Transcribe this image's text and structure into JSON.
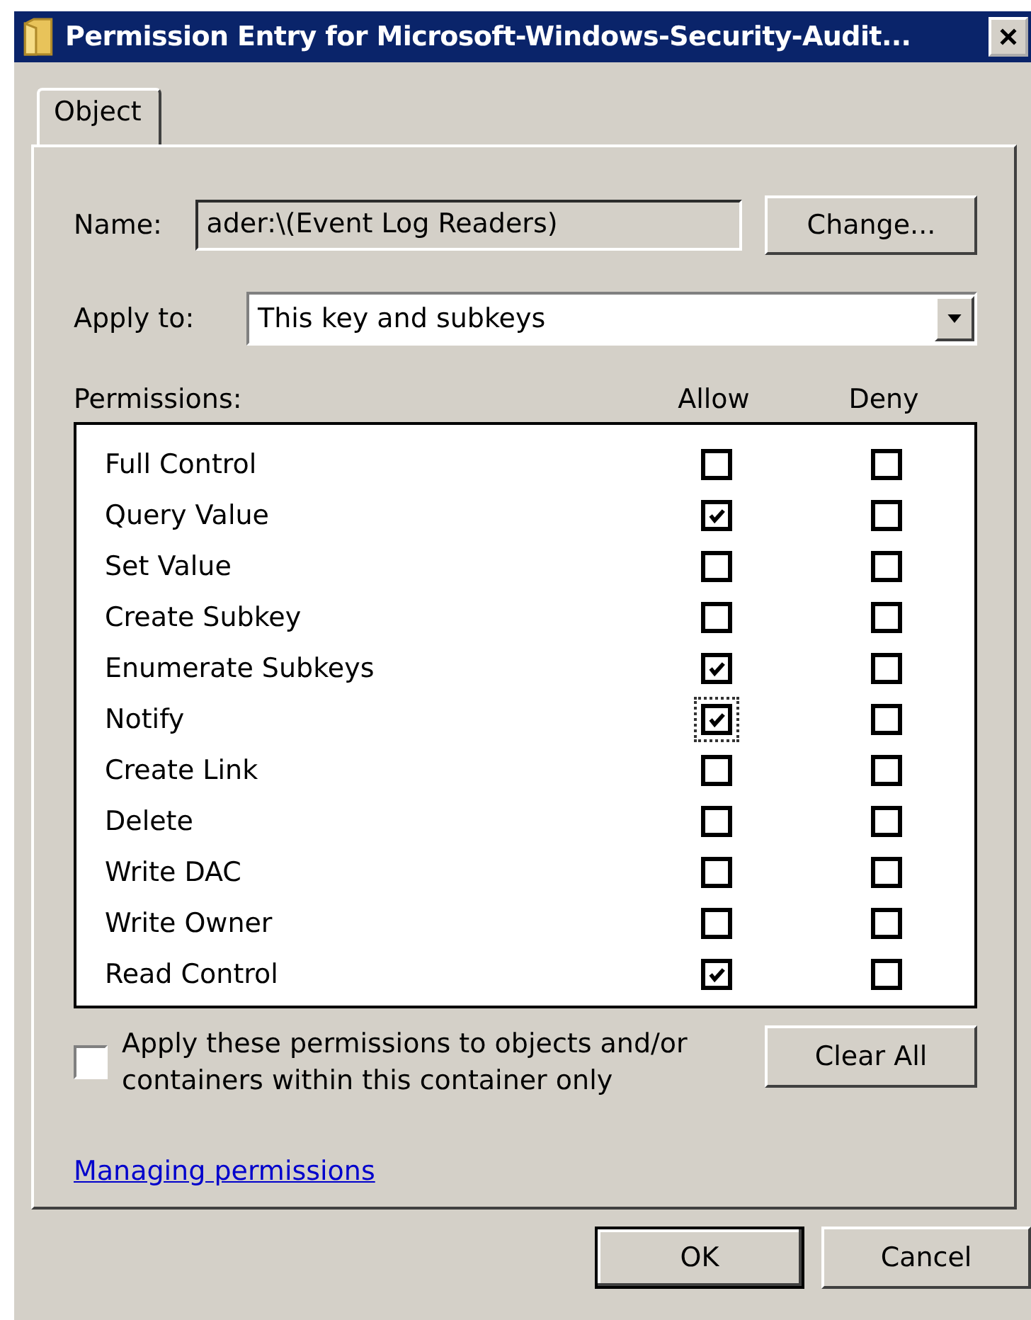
{
  "window": {
    "title": "Permission Entry for Microsoft-Windows-Security-Audit..."
  },
  "tabs": [
    {
      "label": "Object",
      "selected": true
    }
  ],
  "name_field": {
    "label": "Name:",
    "value": "ader:\\(Event Log Readers)",
    "disabled": true
  },
  "change_button": "Change...",
  "apply_to": {
    "label": "Apply to:",
    "value": "This key and subkeys"
  },
  "permissions": {
    "label": "Permissions:",
    "columns": [
      "Allow",
      "Deny"
    ],
    "rows": [
      {
        "name": "Full Control",
        "allow": false,
        "deny": false,
        "focused": false
      },
      {
        "name": "Query Value",
        "allow": true,
        "deny": false,
        "focused": false
      },
      {
        "name": "Set Value",
        "allow": false,
        "deny": false,
        "focused": false
      },
      {
        "name": "Create Subkey",
        "allow": false,
        "deny": false,
        "focused": false
      },
      {
        "name": "Enumerate Subkeys",
        "allow": true,
        "deny": false,
        "focused": false
      },
      {
        "name": "Notify",
        "allow": true,
        "deny": false,
        "focused": true
      },
      {
        "name": "Create Link",
        "allow": false,
        "deny": false,
        "focused": false
      },
      {
        "name": "Delete",
        "allow": false,
        "deny": false,
        "focused": false
      },
      {
        "name": "Write DAC",
        "allow": false,
        "deny": false,
        "focused": false
      },
      {
        "name": "Write Owner",
        "allow": false,
        "deny": false,
        "focused": false
      },
      {
        "name": "Read Control",
        "allow": true,
        "deny": false,
        "focused": false
      }
    ]
  },
  "apply_only": {
    "label": "Apply these permissions to objects and/or containers within this container only",
    "checked": false
  },
  "clear_all_button": "Clear All",
  "help_link": "Managing permissions",
  "buttons": [
    {
      "label": "OK",
      "default": true
    },
    {
      "label": "Cancel",
      "default": false
    }
  ]
}
